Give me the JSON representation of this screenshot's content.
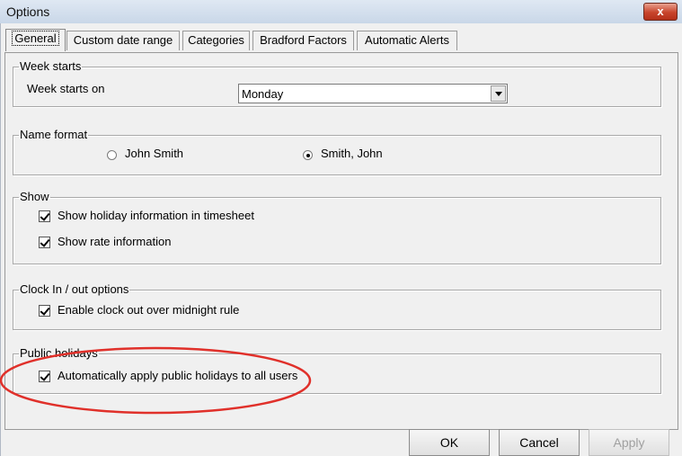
{
  "window": {
    "title": "Options",
    "close_label": "x"
  },
  "tabs": [
    {
      "label": "General",
      "active": true
    },
    {
      "label": "Custom date range",
      "active": false
    },
    {
      "label": "Categories",
      "active": false
    },
    {
      "label": "Bradford Factors",
      "active": false
    },
    {
      "label": "Automatic Alerts",
      "active": false
    }
  ],
  "week_starts": {
    "legend": "Week starts",
    "label": "Week starts on",
    "value": "Monday"
  },
  "name_format": {
    "legend": "Name format",
    "options": [
      {
        "label": "John Smith",
        "selected": false
      },
      {
        "label": "Smith, John",
        "selected": true
      }
    ]
  },
  "show": {
    "legend": "Show",
    "items": [
      {
        "label": "Show holiday information in timesheet",
        "checked": true
      },
      {
        "label": "Show rate information",
        "checked": true
      }
    ]
  },
  "clock": {
    "legend": "Clock In / out options",
    "items": [
      {
        "label": "Enable clock out over midnight rule",
        "checked": true
      }
    ]
  },
  "public_holidays": {
    "legend": "Public holidays",
    "items": [
      {
        "label": "Automatically apply public holidays to all users",
        "checked": true
      }
    ]
  },
  "buttons": {
    "ok": "OK",
    "cancel": "Cancel",
    "apply": "Apply",
    "apply_enabled": false
  },
  "colors": {
    "annotation": "#e0302a",
    "title_bar": "#c9d7e8",
    "close_button": "#c8442b"
  }
}
